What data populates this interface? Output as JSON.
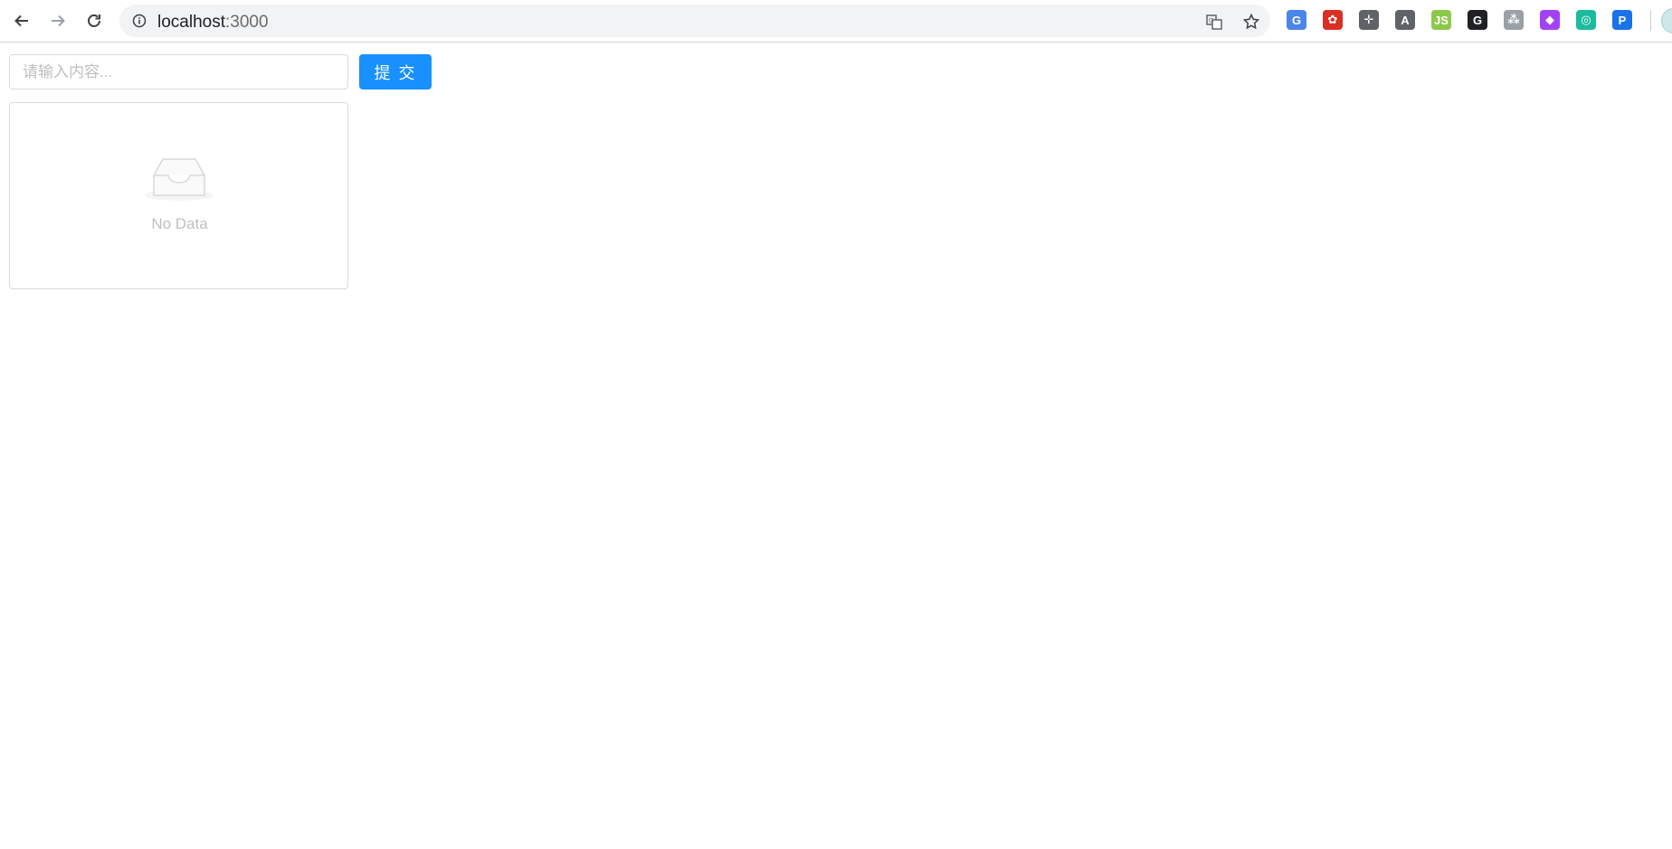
{
  "browser": {
    "url_host": "localhost",
    "url_port": ":3000",
    "nav": {
      "back_icon": "back-arrow-icon",
      "forward_icon": "forward-arrow-icon",
      "reload_icon": "reload-icon"
    },
    "extensions": [
      {
        "name": "google-translate-ext-icon",
        "glyph": "G",
        "color": "#4a86e8"
      },
      {
        "name": "red-ext-icon",
        "glyph": "✿",
        "color": "#d93025"
      },
      {
        "name": "move-ext-icon",
        "glyph": "✛",
        "color": "#5f6368"
      },
      {
        "name": "angular-ext-icon",
        "glyph": "A",
        "color": "#5f6368"
      },
      {
        "name": "nodejs-ext-icon",
        "glyph": "JS",
        "color": "#8cc84b"
      },
      {
        "name": "grammarly-ext-icon",
        "glyph": "G",
        "color": "#202124"
      },
      {
        "name": "tree-ext-icon",
        "glyph": "⁂",
        "color": "#9aa0a6"
      },
      {
        "name": "purple-ext-icon",
        "glyph": "◆",
        "color": "#a142f4"
      },
      {
        "name": "target-ext-icon",
        "glyph": "◎",
        "color": "#1abc9c"
      },
      {
        "name": "pocket-p-ext-icon",
        "glyph": "P",
        "color": "#1a73e8"
      }
    ]
  },
  "form": {
    "input_placeholder": "请输入内容...",
    "input_value": "",
    "submit_label": "提 交"
  },
  "list": {
    "empty_text": "No Data"
  },
  "colors": {
    "primary": "#1890ff",
    "border": "#d9d9d9",
    "placeholder": "#bfbfbf"
  }
}
